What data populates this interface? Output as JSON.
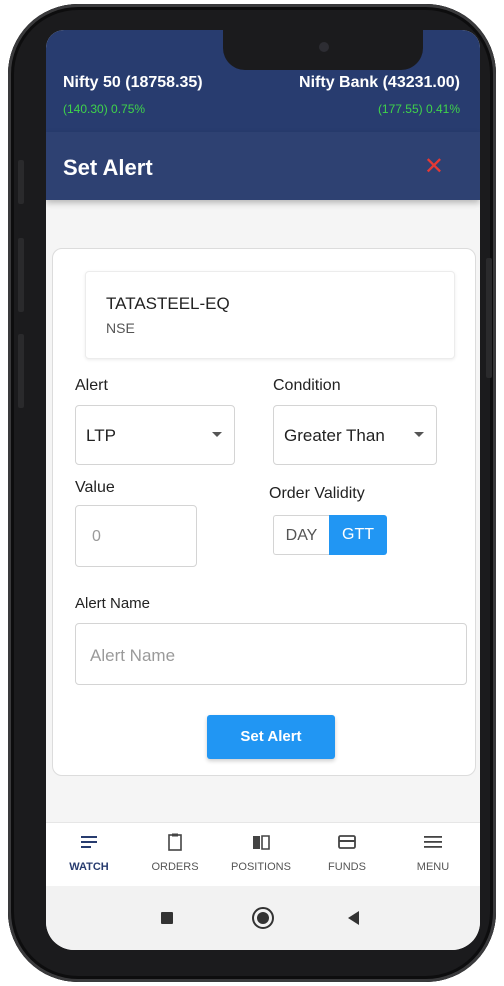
{
  "ticker": {
    "left_index": "Nifty 50 (18758.35)",
    "left_change": "(140.30) 0.75%",
    "right_index": "Nifty Bank (43231.00)",
    "right_change": "(177.55) 0.41%"
  },
  "header": {
    "title": "Set Alert",
    "close_icon": "close-x-icon"
  },
  "instrument": {
    "symbol": "TATASTEEL-EQ",
    "exchange": "NSE"
  },
  "form": {
    "alert_label": "Alert",
    "alert_value": "LTP",
    "condition_label": "Condition",
    "condition_value": "Greater Than",
    "value_label": "Value",
    "value_placeholder": "0",
    "validity_label": "Order Validity",
    "validity_options": [
      "DAY",
      "GTT"
    ],
    "validity_selected": "GTT",
    "name_label": "Alert Name",
    "name_placeholder": "Alert Name",
    "submit_label": "Set Alert"
  },
  "bottom_nav": [
    {
      "label": "WATCH",
      "icon": "list-icon",
      "active": true
    },
    {
      "label": "ORDERS",
      "icon": "clipboard-icon",
      "active": false
    },
    {
      "label": "POSITIONS",
      "icon": "book-icon",
      "active": false
    },
    {
      "label": "FUNDS",
      "icon": "card-icon",
      "active": false
    },
    {
      "label": "MENU",
      "icon": "menu-icon",
      "active": false
    }
  ],
  "colors": {
    "header": "#2e4172",
    "accent": "#2196f3",
    "positive": "#3fd34a",
    "close": "#e53935"
  }
}
